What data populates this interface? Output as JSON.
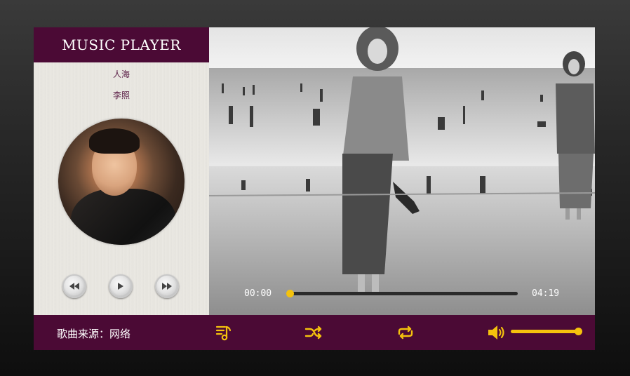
{
  "app": {
    "title": "MUSIC PLAYER"
  },
  "song": {
    "title": "人海",
    "artist": "李照"
  },
  "playback": {
    "current_time": "00:00",
    "total_time": "04:19",
    "progress": 0.0
  },
  "controls": {
    "prev_icon": "rewind-icon",
    "play_icon": "play-icon",
    "next_icon": "fast-forward-icon"
  },
  "bottom_bar": {
    "source_label": "歌曲来源：网络",
    "playlist_icon": "playlist-icon",
    "shuffle_icon": "shuffle-icon",
    "repeat_icon": "repeat-icon",
    "volume_icon": "volume-icon",
    "volume": 1.0
  },
  "colors": {
    "brand": "#4b0a35",
    "accent": "#f4c20d",
    "panel": "#e9e7e2"
  }
}
